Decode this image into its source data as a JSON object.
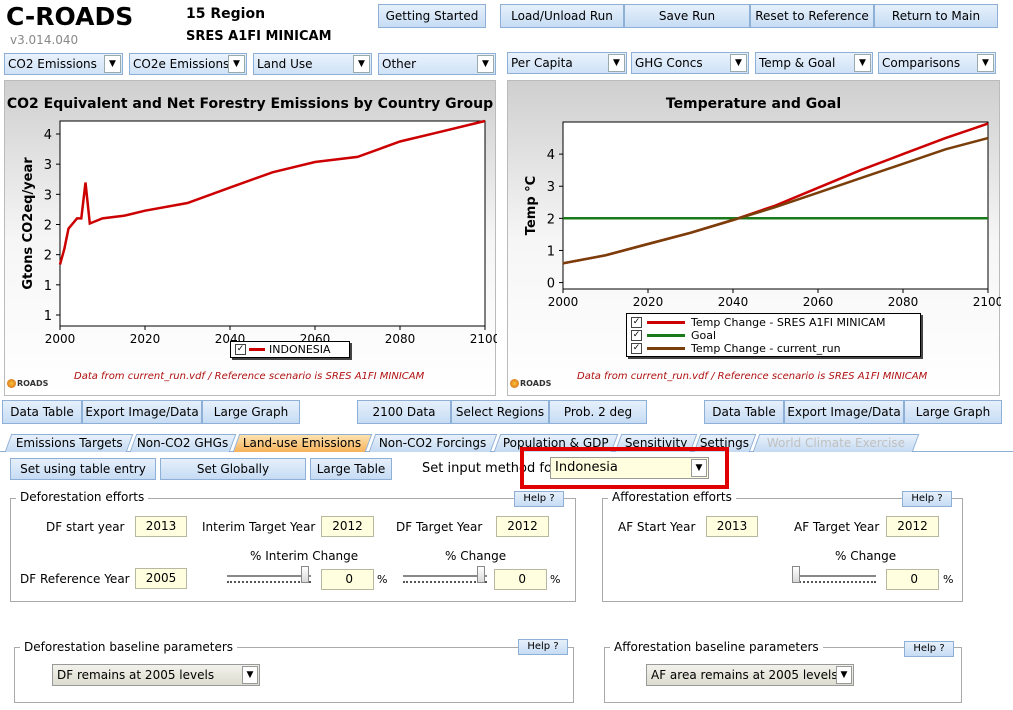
{
  "app": {
    "title": "C-ROADS",
    "version": "v3.014.040",
    "region": "15 Region",
    "scenario": "SRES A1FI MINICAM"
  },
  "top_buttons": [
    "Getting Started",
    "Load/Unload Run",
    "Save Run",
    "Reset to Reference",
    "Return to Main"
  ],
  "left_dropdowns": [
    "CO2 Emissions",
    "CO2e Emissions",
    "Land Use",
    "Other"
  ],
  "right_dropdowns": [
    "Per Capita",
    "GHG Concs",
    "Temp & Goal",
    "Comparisons"
  ],
  "colors": {
    "accent_red": "#cc0000",
    "goal_green": "#1a7a1a",
    "brown": "#7a3e0a",
    "highlight_box": "#e00000"
  },
  "chart_left": {
    "title": "CO2 Equivalent and Net Forestry Emissions by Country Group",
    "ylabel": "Gtons CO2eq/year",
    "yticks": [
      "4",
      "3",
      "3",
      "2",
      "2",
      "1",
      "1"
    ],
    "xticks": [
      "2000",
      "2020",
      "2040",
      "2060",
      "2080",
      "2100"
    ],
    "legend": "INDONESIA",
    "legend_checked": "✓",
    "note": "Data from current_run.vdf / Reference scenario is SRES A1FI MINICAM"
  },
  "chart_right": {
    "title": "Temperature and Goal",
    "ylabel": "Temp °C",
    "yticks": [
      "4",
      "3",
      "2",
      "1",
      "0"
    ],
    "xticks": [
      "2000",
      "2020",
      "2040",
      "2060",
      "2080",
      "2100"
    ],
    "legend": [
      "Temp Change - SRES A1FI MINICAM",
      "Goal",
      "Temp Change - current_run"
    ],
    "legend_checked": "✓",
    "note": "Data from current_run.vdf / Reference scenario is SRES A1FI MINICAM"
  },
  "logo_text": "ROADS",
  "chart_data": [
    {
      "type": "line",
      "title": "CO2 Equivalent and Net Forestry Emissions by Country Group",
      "ylabel": "Gtons CO2eq/year",
      "ylim": [
        0.5,
        4.5
      ],
      "xlim": [
        2000,
        2100
      ],
      "series": [
        {
          "name": "INDONESIA",
          "color": "#cc0000",
          "x": [
            2000,
            2001,
            2002,
            2003,
            2004,
            2005,
            2006,
            2007,
            2010,
            2015,
            2020,
            2030,
            2040,
            2050,
            2060,
            2070,
            2080,
            2090,
            2100
          ],
          "y": [
            1.7,
            2.0,
            2.4,
            2.5,
            2.6,
            2.6,
            3.3,
            2.5,
            2.6,
            2.65,
            2.75,
            2.9,
            3.2,
            3.5,
            3.7,
            3.8,
            4.1,
            4.3,
            4.5
          ]
        }
      ]
    },
    {
      "type": "line",
      "title": "Temperature and Goal",
      "ylabel": "Temp °C",
      "ylim": [
        -0.2,
        5
      ],
      "xlim": [
        2000,
        2100
      ],
      "series": [
        {
          "name": "Temp Change - SRES A1FI MINICAM",
          "color": "#cc0000",
          "x": [
            2000,
            2010,
            2020,
            2030,
            2040,
            2050,
            2060,
            2070,
            2080,
            2090,
            2100
          ],
          "y": [
            0.6,
            0.85,
            1.2,
            1.55,
            1.95,
            2.4,
            2.95,
            3.5,
            4.0,
            4.5,
            4.95
          ]
        },
        {
          "name": "Goal",
          "color": "#1a7a1a",
          "x": [
            2000,
            2100
          ],
          "y": [
            2.0,
            2.0
          ]
        },
        {
          "name": "Temp Change - current_run",
          "color": "#7a3e0a",
          "x": [
            2000,
            2010,
            2020,
            2030,
            2040,
            2050,
            2060,
            2070,
            2080,
            2090,
            2100
          ],
          "y": [
            0.6,
            0.85,
            1.2,
            1.55,
            1.95,
            2.35,
            2.8,
            3.25,
            3.7,
            4.15,
            4.5
          ]
        }
      ]
    }
  ],
  "mid_buttons_left": [
    "Data Table",
    "Export Image/Data",
    "Large Graph"
  ],
  "mid_buttons_center": [
    "2100 Data",
    "Select Regions",
    "Prob. 2 deg"
  ],
  "mid_buttons_right": [
    "Data Table",
    "Export Image/Data",
    "Large Graph"
  ],
  "tabs": [
    "Emissions Targets",
    "Non-CO2 GHGs",
    "Land-use Emissions",
    "Non-CO2 Forcings",
    "Population & GDP",
    "Sensitivity",
    "Settings",
    "World Climate Exercise"
  ],
  "active_tab": "Land-use Emissions",
  "input_row": {
    "set_table": "Set using table entry",
    "set_globally": "Set Globally",
    "large_table": "Large Table",
    "method_label": "Set input method for",
    "method_value": "Indonesia"
  },
  "deforestation": {
    "title": "Deforestation efforts",
    "help": "Help ?",
    "start_label": "DF start year",
    "start_value": "2013",
    "interim_label": "Interim Target Year",
    "interim_value": "2012",
    "target_label": "DF Target Year",
    "target_value": "2012",
    "ref_label": "DF Reference Year",
    "ref_value": "2005",
    "interim_change_label": "% Interim Change",
    "interim_change_value": "0",
    "change_label": "% Change",
    "change_value": "0",
    "pct": "%",
    "interim_slider_level": 1.0,
    "change_slider_level": 1.0
  },
  "afforestation": {
    "title": "Afforestation efforts",
    "help": "Help ?",
    "start_label": "AF Start Year",
    "start_value": "2013",
    "target_label": "AF Target Year",
    "target_value": "2012",
    "change_label": "% Change",
    "change_value": "0",
    "pct": "%",
    "change_slider_level": 0.0
  },
  "df_baseline": {
    "title": "Deforestation baseline parameters",
    "help": "Help ?",
    "value": "DF remains at 2005 levels"
  },
  "af_baseline": {
    "title": "Afforestation baseline parameters",
    "help": "Help ?",
    "value": "AF area remains at 2005 levels"
  }
}
